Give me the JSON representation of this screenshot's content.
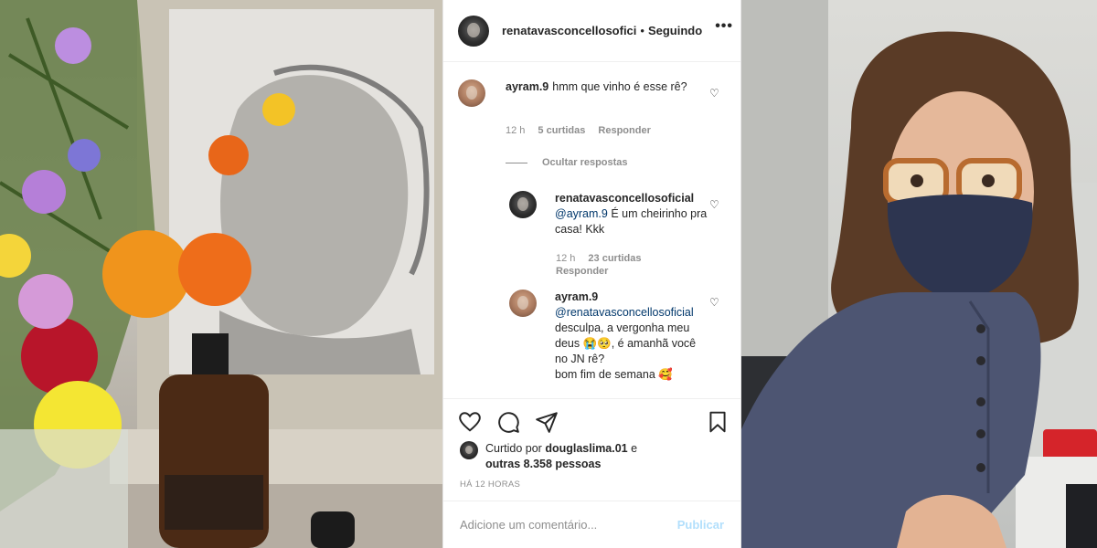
{
  "post": {
    "username": "renatavasconcellosoficial",
    "header_username_display": "renatavasconcellosofici",
    "follow_status": "Seguindo",
    "more_glyph": "•••"
  },
  "comments": [
    {
      "user": "ayram.9",
      "text": "hmm que vinho é esse rê?",
      "time": "12 h",
      "likes": "5 curtidas",
      "reply": "Responder"
    }
  ],
  "hide_replies": "Ocultar respostas",
  "replies": [
    {
      "user": "renatavasconcellosoficial",
      "mention": "@ayram.9",
      "text": "É um cheirinho pra casa! Kkk",
      "time": "12 h",
      "likes": "23 curtidas",
      "reply": "Responder"
    },
    {
      "user": "ayram.9",
      "mention": "@renatavasconcellosoficial",
      "text": "desculpa, a vergonha meu deus 😭🥺, é amanhã você no JN rê?",
      "text_cut": "bom fim de semana 🥰"
    }
  ],
  "actions": {
    "liked_by_prefix": "Curtido por",
    "liked_by_user": "douglaslima.01",
    "liked_by_mid": "e",
    "liked_by_others": "outras 8.358 pessoas",
    "timestamp": "HÁ 12 HORAS"
  },
  "comment_box": {
    "placeholder": "Adicione um comentário...",
    "publish": "Publicar"
  },
  "icons": [
    "heart-icon",
    "comment-icon",
    "share-icon",
    "bookmark-icon",
    "more-icon"
  ],
  "colors": {
    "link_blue": "#00376b",
    "muted": "#8e8e8e",
    "publish_disabled": "#b2dffc"
  }
}
